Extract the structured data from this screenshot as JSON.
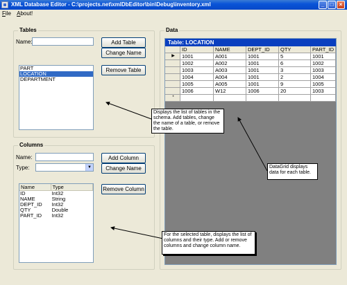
{
  "window": {
    "title": "XML Database Editor - C:\\projects.net\\xmlDbEditor\\bin\\Debug\\inventory.xml"
  },
  "menu": [
    "File",
    "About!"
  ],
  "tables_panel": {
    "legend": "Tables",
    "name_label": "Name:",
    "name_value": "",
    "add_button": "Add Table",
    "change_button": "Change Name",
    "remove_button": "Remove Table",
    "items": [
      "PART",
      "LOCATION",
      "DEPARTMENT"
    ],
    "selected_index": 1
  },
  "columns_panel": {
    "legend": "Columns",
    "name_label": "Name:",
    "type_label": "Type:",
    "name_value": "",
    "type_value": "",
    "add_button": "Add Column",
    "change_button": "Change Name",
    "remove_button": "Remove Column",
    "headers": [
      "Name",
      "Type"
    ],
    "rows": [
      [
        "ID",
        "Int32"
      ],
      [
        "NAME",
        "String"
      ],
      [
        "DEPT_ID",
        "Int32"
      ],
      [
        "QTY",
        "Double"
      ],
      [
        "PART_ID",
        "Int32"
      ]
    ]
  },
  "data_panel": {
    "legend": "Data",
    "caption": "Table: LOCATION",
    "headers": [
      "ID",
      "NAME",
      "DEPT_ID",
      "QTY",
      "PART_ID"
    ],
    "rows": [
      [
        "1001",
        "A001",
        "1001",
        "5",
        "1001"
      ],
      [
        "1002",
        "A002",
        "1001",
        "6",
        "1002"
      ],
      [
        "1003",
        "A003",
        "1001",
        "3",
        "1003"
      ],
      [
        "1004",
        "A004",
        "1001",
        "2",
        "1004"
      ],
      [
        "1005",
        "A005",
        "1001",
        "9",
        "1005"
      ],
      [
        "1006",
        "W12",
        "1006",
        "20",
        "1003"
      ]
    ],
    "current_row_marker": "▶",
    "new_row_marker": "*"
  },
  "callouts": {
    "tables": "Displays the list of tables in the schema.  Add tables, change the name of a table, or remove the table.",
    "datagrid": "DataGrid displays data for each table.",
    "columns": "For the selected table, displays the list of columns and their type.  Add or remove columns and change column name."
  }
}
